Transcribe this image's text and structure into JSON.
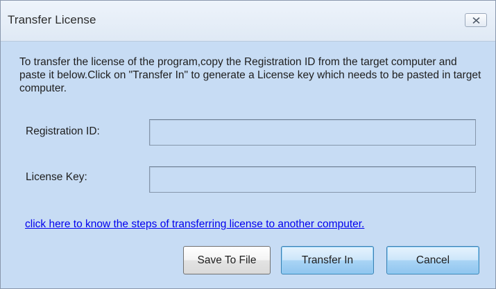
{
  "window": {
    "title": "Transfer License",
    "close_icon": "close-x-icon"
  },
  "description": "To transfer the license of the program,copy the Registration ID from the target computer and paste it below.Click on \"Transfer In\" to generate a License key which needs to be pasted in target computer.",
  "fields": {
    "registration_id": {
      "label": "Registration ID:",
      "value": ""
    },
    "license_key": {
      "label": "License Key:",
      "value": ""
    }
  },
  "help_link": "click here to know the steps of transferring license to another computer.",
  "buttons": {
    "save_to_file": "Save To File",
    "transfer_in": "Transfer In",
    "cancel": "Cancel"
  },
  "colors": {
    "dialog_background": "#c7dcf4",
    "link": "#0000ee",
    "accent_button": "#a9d4f5"
  }
}
